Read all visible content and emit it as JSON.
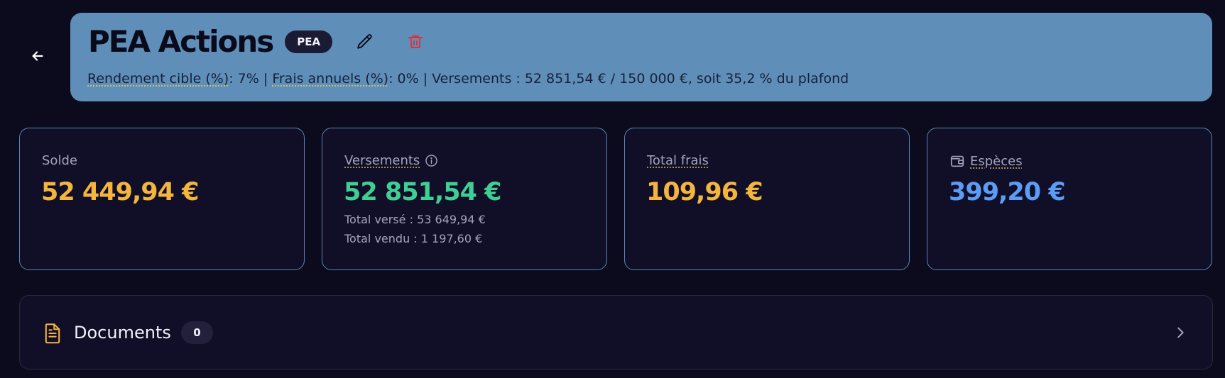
{
  "header": {
    "title": "PEA Actions",
    "badge": "PEA",
    "subtitle": {
      "target_label": "Rendement cible (%)",
      "target_value": ": 7% | ",
      "fees_label": "Frais annuels (%)",
      "rest": ": 0% | Versements : 52 851,54 € / 150 000 €, soit 35,2 % du plafond"
    }
  },
  "cards": [
    {
      "label": "Solde",
      "value": "52 449,94 €",
      "value_color": "#f3b53e"
    },
    {
      "label": "Versements",
      "value": "52 851,54 €",
      "value_color": "#3fcf94",
      "sub1": "Total versé : 53 649,94 €",
      "sub2": "Total vendu : 1 197,60 €"
    },
    {
      "label": "Total frais",
      "value": "109,96 €",
      "value_color": "#f3b53e"
    },
    {
      "label": "Espèces",
      "value": "399,20 €",
      "value_color": "#5b9cf6"
    }
  ],
  "documents": {
    "title": "Documents",
    "count": "0"
  },
  "icons": {
    "back": "arrow-left-icon",
    "edit": "pencil-icon",
    "delete": "trash-icon",
    "info": "info-icon",
    "wallet": "wallet-icon",
    "document": "document-icon",
    "chevron": "chevron-right-icon"
  },
  "colors": {
    "background": "#0c0a1d",
    "header_bg": "#5f8fb8",
    "card_border": "#5b86b6",
    "delete_red": "#d9343d",
    "documents_icon": "#f3b53e"
  }
}
